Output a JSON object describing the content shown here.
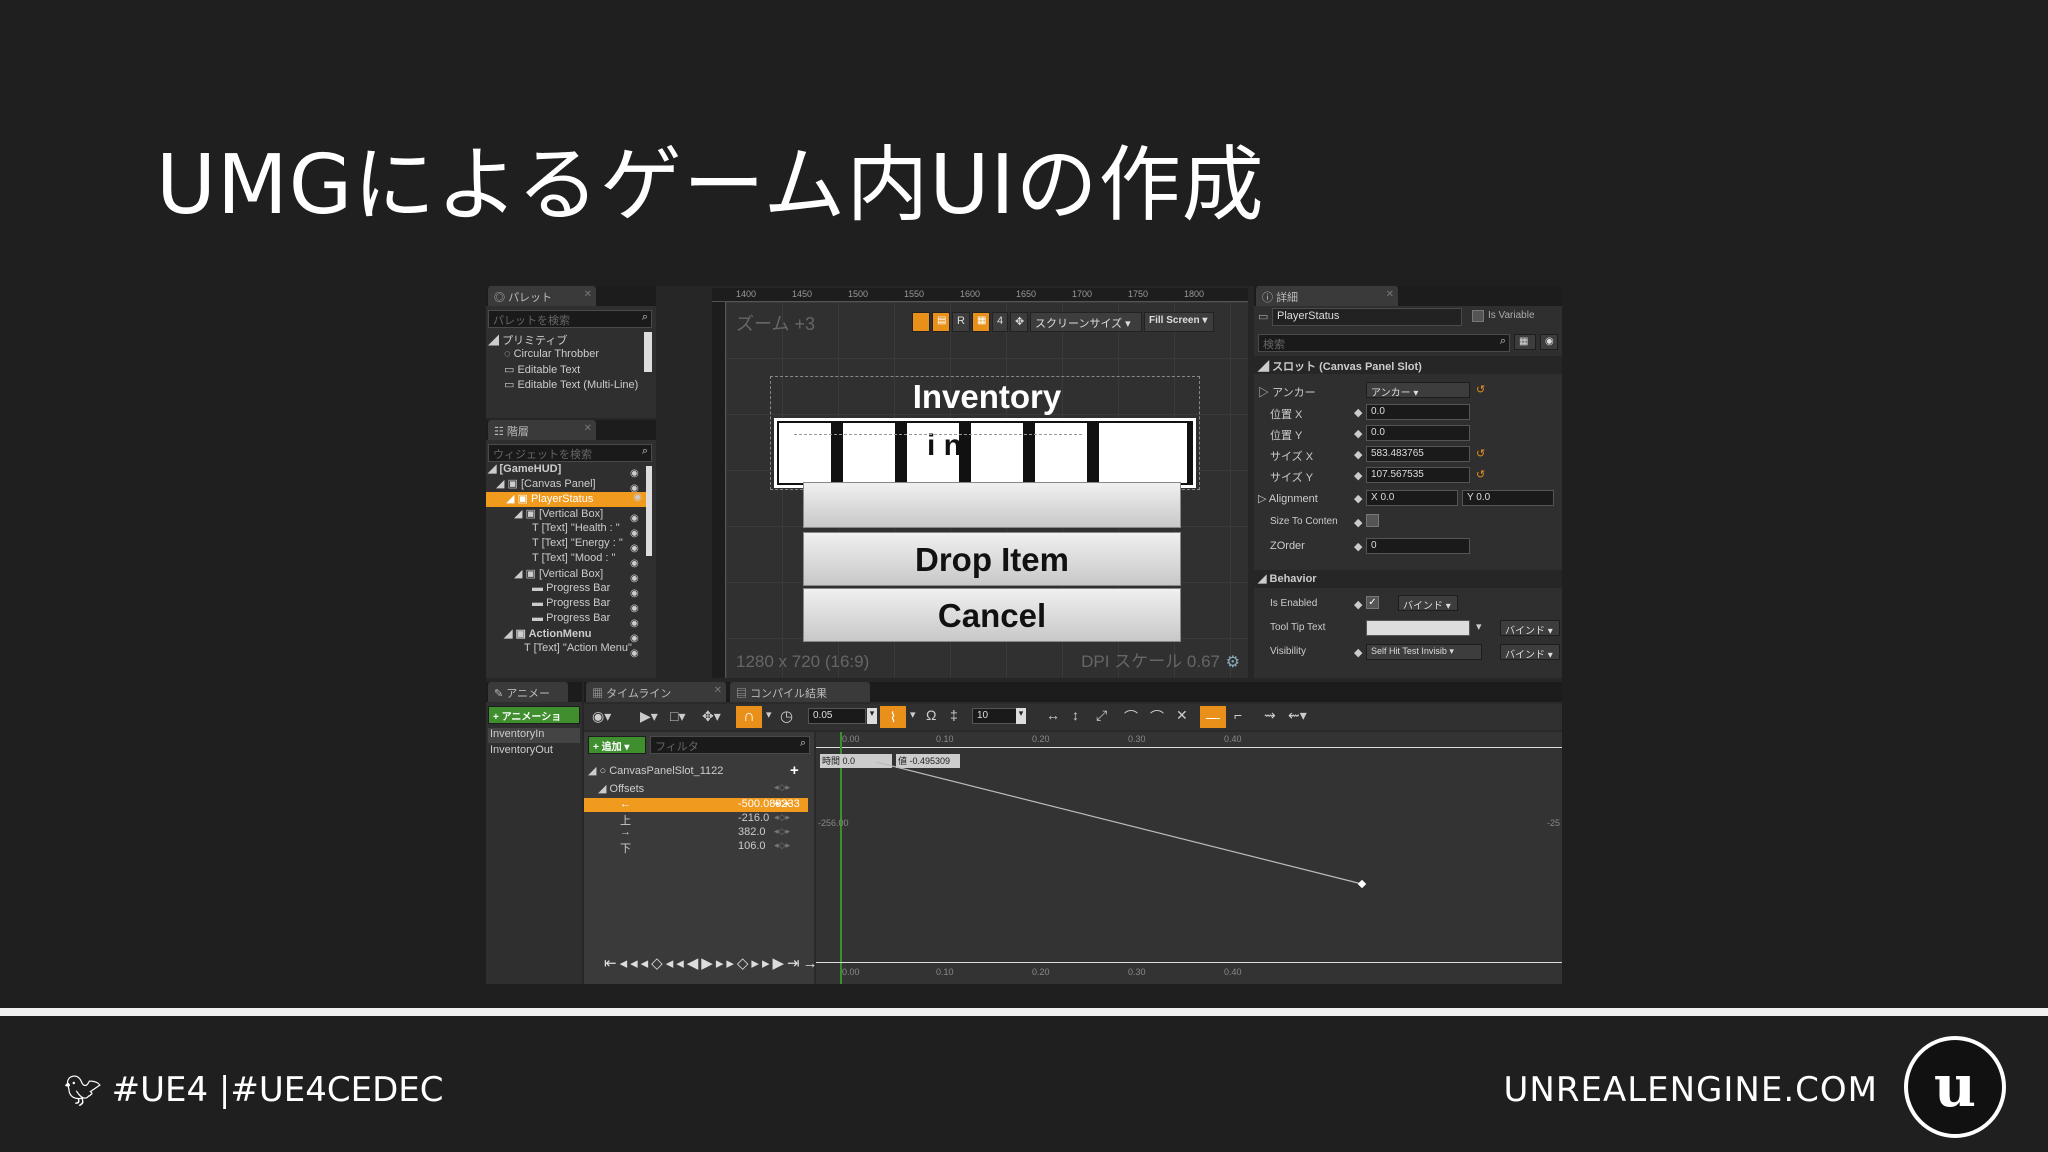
{
  "slide": {
    "title": "UMGによるゲーム内UIの作成",
    "hashtags": "#UE4 |#UE4CEDEC",
    "site": "UNREALENGINE.COM"
  },
  "palette": {
    "tab": "パレット",
    "search": "パレットを検索",
    "category": "プリミティブ",
    "items": [
      "Circular Throbber",
      "Editable Text",
      "Editable Text (Multi-Line)"
    ]
  },
  "hierarchy": {
    "tab": "階層",
    "search": "ウィジェットを検索",
    "rows": [
      "[GameHUD]",
      "[Canvas Panel]",
      "PlayerStatus",
      "[Vertical Box]",
      "[Text] \"Health : \"",
      "[Text] \"Energy : \"",
      "[Text] \"Mood : \"",
      "[Vertical Box]",
      "Progress Bar",
      "Progress Bar",
      "Progress Bar",
      "ActionMenu",
      "[Text] \"Action Menu\""
    ]
  },
  "designer": {
    "zoom": "ズーム +3",
    "screen_size": "スクリーンサイズ",
    "fill": "Fill Screen",
    "resolution": "1280 x 720 (16:9)",
    "dpi": "DPI スケール 0.67",
    "ruler": [
      "1400",
      "1450",
      "1500",
      "1550",
      "1600",
      "1650",
      "1700",
      "1750",
      "1800"
    ],
    "r_btn": "R",
    "four": "4"
  },
  "ui_preview": {
    "inventory": "Inventory",
    "drop": "Drop Item",
    "cancel": "Cancel",
    "hidden": "i     n"
  },
  "details": {
    "tab": "詳細",
    "name": "PlayerStatus",
    "is_variable": "Is Variable",
    "search": "検索",
    "slot_section": "スロット (Canvas Panel Slot)",
    "anchor_label": "アンカー",
    "anchor_value": "アンカー",
    "pos_x_label": "位置 X",
    "pos_x": "0.0",
    "pos_y_label": "位置 Y",
    "pos_y": "0.0",
    "size_x_label": "サイズ X",
    "size_x": "583.483765",
    "size_y_label": "サイズ Y",
    "size_y": "107.567535",
    "alignment_label": "Alignment",
    "align_x": "X  0.0",
    "align_y": "Y  0.0",
    "size_to_content": "Size To Conten",
    "zorder_label": "ZOrder",
    "zorder": "0",
    "behavior": "Behavior",
    "is_enabled": "Is Enabled",
    "tooltip": "Tool Tip Text",
    "visibility": "Visibility",
    "visibility_value": "Self Hit Test Invisib",
    "bind": "バインド"
  },
  "animations": {
    "tab": "アニメー",
    "add": "+ アニメーショ",
    "items": [
      "InventoryIn",
      "InventoryOut"
    ]
  },
  "timeline": {
    "tab": "タイムライン",
    "compile_tab": "コンパイル結果",
    "step": "0.05",
    "frames": "10",
    "add": "+ 追加",
    "filter": "フィルタ",
    "track": "CanvasPanelSlot_1122",
    "offsets": "Offsets",
    "rows": [
      {
        "k": "←",
        "v": "-500.089233"
      },
      {
        "k": "上",
        "v": "-216.0"
      },
      {
        "k": "→",
        "v": "382.0"
      },
      {
        "k": "下",
        "v": "106.0"
      }
    ],
    "time_label": "時間",
    "time_val": "0.0",
    "value_label": "値",
    "value_val": "-0.495309",
    "y_label": "-256.00",
    "y_label_right": "-25",
    "x_ticks": [
      "0.00",
      "0.10",
      "0.20",
      "0.30",
      "0.40"
    ],
    "bottom_ticks": [
      "0.00",
      "0.10",
      "0.20",
      "0.30",
      "0.40"
    ]
  }
}
